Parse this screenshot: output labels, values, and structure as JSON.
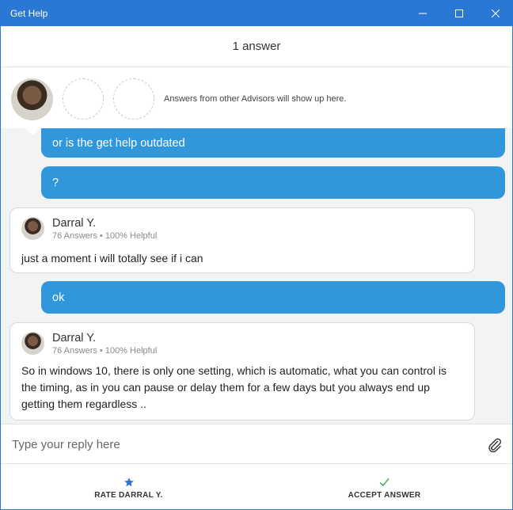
{
  "window": {
    "title": "Get Help"
  },
  "header": {
    "answer_count": "1 answer"
  },
  "advisors_strip": {
    "note": "Answers from other Advisors will show up here."
  },
  "messages": [
    {
      "from": "user",
      "text": "or is the get help outdated"
    },
    {
      "from": "user",
      "text": "?"
    },
    {
      "from": "advisor",
      "name": "Darral Y.",
      "meta": "76 Answers • 100% Helpful",
      "text": "just a moment i will totally see if i can"
    },
    {
      "from": "user",
      "text": "ok"
    },
    {
      "from": "advisor",
      "name": "Darral Y.",
      "meta": "76 Answers • 100% Helpful",
      "text": "So in windows 10, there is only one setting, which is automatic, what you can control is the timing, as in you can pause or delay them for a few days but you always end up getting them regardless .."
    }
  ],
  "reply": {
    "placeholder": "Type your reply here"
  },
  "footer": {
    "rate_label": "RATE DARRAL Y.",
    "accept_label": "ACCEPT ANSWER"
  },
  "colors": {
    "titlebar": "#2b78d4",
    "user_bubble": "#3197dc",
    "chat_background": "#f2f3f4",
    "star": "#2b78d4",
    "check": "#3aa655"
  },
  "icons": {
    "minimize": "minimize-icon",
    "maximize": "maximize-icon",
    "close": "close-icon",
    "attach": "paperclip-icon",
    "rate": "star-icon",
    "accept": "checkmark-icon"
  }
}
